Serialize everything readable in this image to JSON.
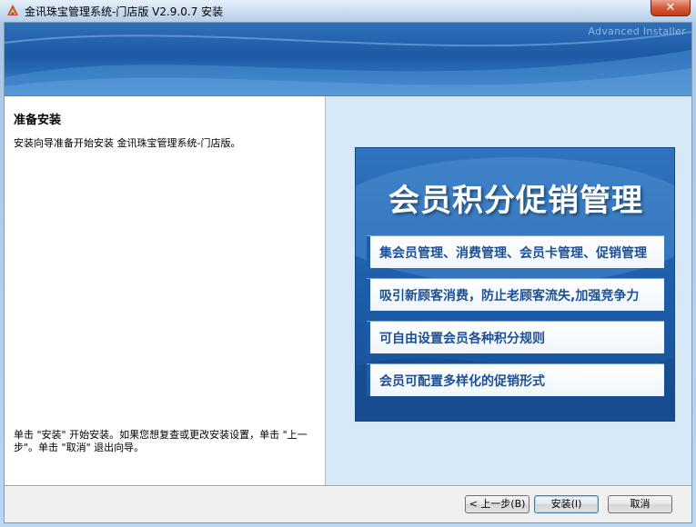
{
  "window": {
    "title": "金讯珠宝管理系统-门店版 V2.9.0.7 安装",
    "close_glyph": "✕"
  },
  "banner": {
    "brand": "Advanced Installer"
  },
  "page": {
    "heading": "准备安装",
    "description": "安装向导准备开始安装 金讯珠宝管理系统-门店版。",
    "hint": "单击 \"安装\" 开始安装。如果您想复查或更改安装设置，单击 \"上一步\"。单击 \"取消\" 退出向导。"
  },
  "promo": {
    "title": "会员积分促销管理",
    "items": [
      "集会员管理、消费管理、会员卡管理、促销管理",
      "吸引新顾客消费，防止老顾客流失,加强竞争力",
      "可自由设置会员各种积分规则",
      "会员可配置多样化的促销形式"
    ]
  },
  "buttons": {
    "back": "< 上一步(B)",
    "install": "安装(I)",
    "cancel": "取消"
  },
  "colors": {
    "banner": "#1c5aa6",
    "promo_background": "#1c5ca8",
    "promo_text": "#1c4f96",
    "right_pane": "#d7e9f8"
  }
}
